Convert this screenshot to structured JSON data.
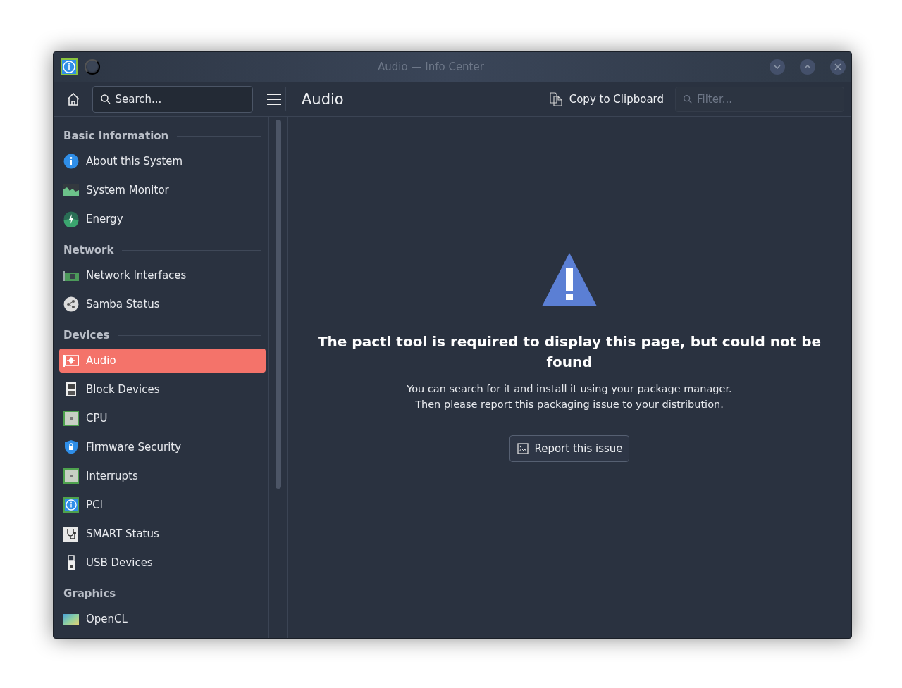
{
  "window": {
    "title": "Audio — Info Center"
  },
  "toolbar": {
    "search": {
      "placeholder": "Search..."
    },
    "page_title": "Audio",
    "copy_button": "Copy to Clipboard",
    "filter": {
      "placeholder": "Filter..."
    }
  },
  "sidebar": {
    "sections": [
      {
        "heading": "Basic Information",
        "items": [
          {
            "label": "About this System",
            "kind": "info",
            "selected": false
          },
          {
            "label": "System Monitor",
            "kind": "monitor",
            "selected": false
          },
          {
            "label": "Energy",
            "kind": "energy",
            "selected": false
          }
        ]
      },
      {
        "heading": "Network",
        "items": [
          {
            "label": "Network Interfaces",
            "kind": "card",
            "selected": false
          },
          {
            "label": "Samba Status",
            "kind": "share",
            "selected": false
          }
        ]
      },
      {
        "heading": "Devices",
        "items": [
          {
            "label": "Audio",
            "kind": "audio",
            "selected": true
          },
          {
            "label": "Block Devices",
            "kind": "disk",
            "selected": false
          },
          {
            "label": "CPU",
            "kind": "chip",
            "selected": false
          },
          {
            "label": "Firmware Security",
            "kind": "shield",
            "selected": false
          },
          {
            "label": "Interrupts",
            "kind": "chip",
            "selected": false
          },
          {
            "label": "PCI",
            "kind": "info-square",
            "selected": false
          },
          {
            "label": "SMART Status",
            "kind": "smart",
            "selected": false
          },
          {
            "label": "USB Devices",
            "kind": "usb",
            "selected": false
          }
        ]
      },
      {
        "heading": "Graphics",
        "items": [
          {
            "label": "OpenCL",
            "kind": "gradient",
            "selected": false
          }
        ]
      }
    ]
  },
  "message": {
    "title": "The pactl tool is required to display this page, but could not be found",
    "lines": [
      "You can search for it and install it using your package manager.",
      "Then please report this packaging issue to your distribution."
    ],
    "button": "Report this issue"
  }
}
